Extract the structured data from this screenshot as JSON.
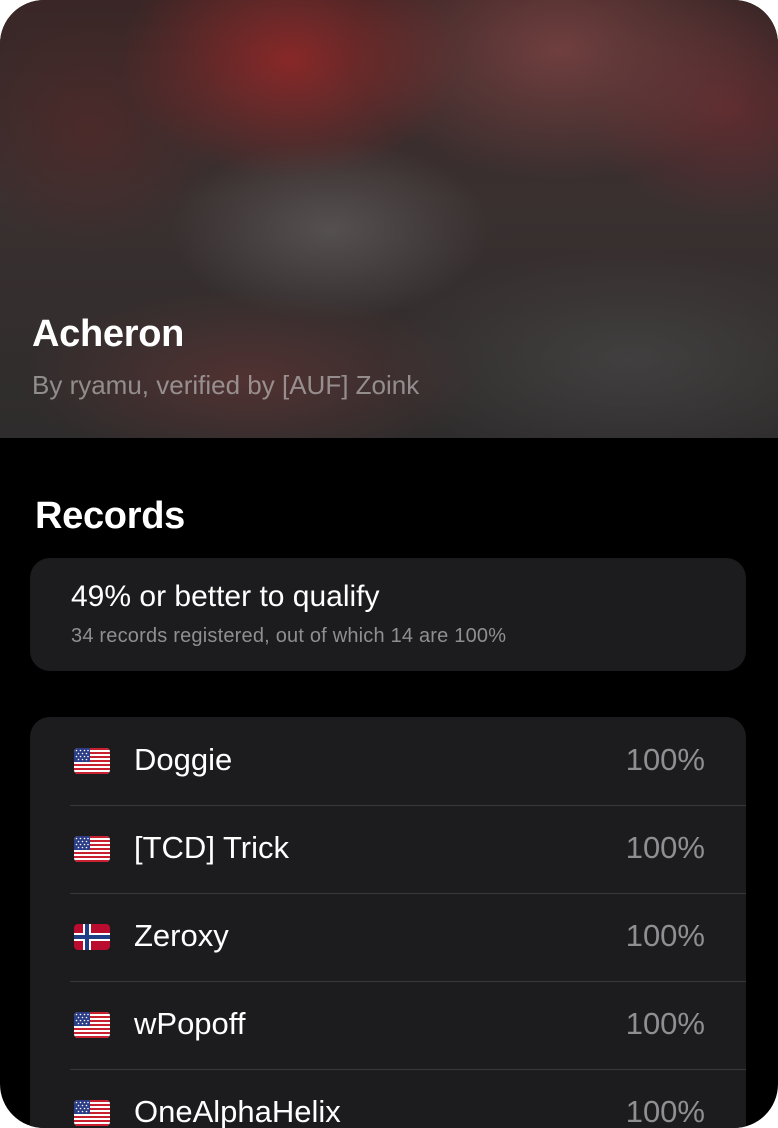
{
  "header": {
    "title": "Acheron",
    "subtitle": "By ryamu, verified by [AUF] Zoink"
  },
  "records_section": {
    "title": "Records",
    "qualify_title": "49% or better to qualify",
    "qualify_subtitle": "34 records registered, out of which 14 are 100%"
  },
  "records": [
    {
      "flag": "us-flag-icon",
      "name": "Doggie",
      "value": "100%"
    },
    {
      "flag": "us-flag-icon",
      "name": "[TCD] Trick",
      "value": "100%"
    },
    {
      "flag": "norway-flag-icon",
      "name": "Zeroxy",
      "value": "100%"
    },
    {
      "flag": "us-flag-icon",
      "name": "wPopoff",
      "value": "100%"
    },
    {
      "flag": "us-flag-icon",
      "name": "OneAlphaHelix",
      "value": "100%"
    }
  ],
  "colors": {
    "background": "#000000",
    "card": "#1c1c1e",
    "secondary_text": "#8e8e93",
    "separator": "#38383a"
  }
}
